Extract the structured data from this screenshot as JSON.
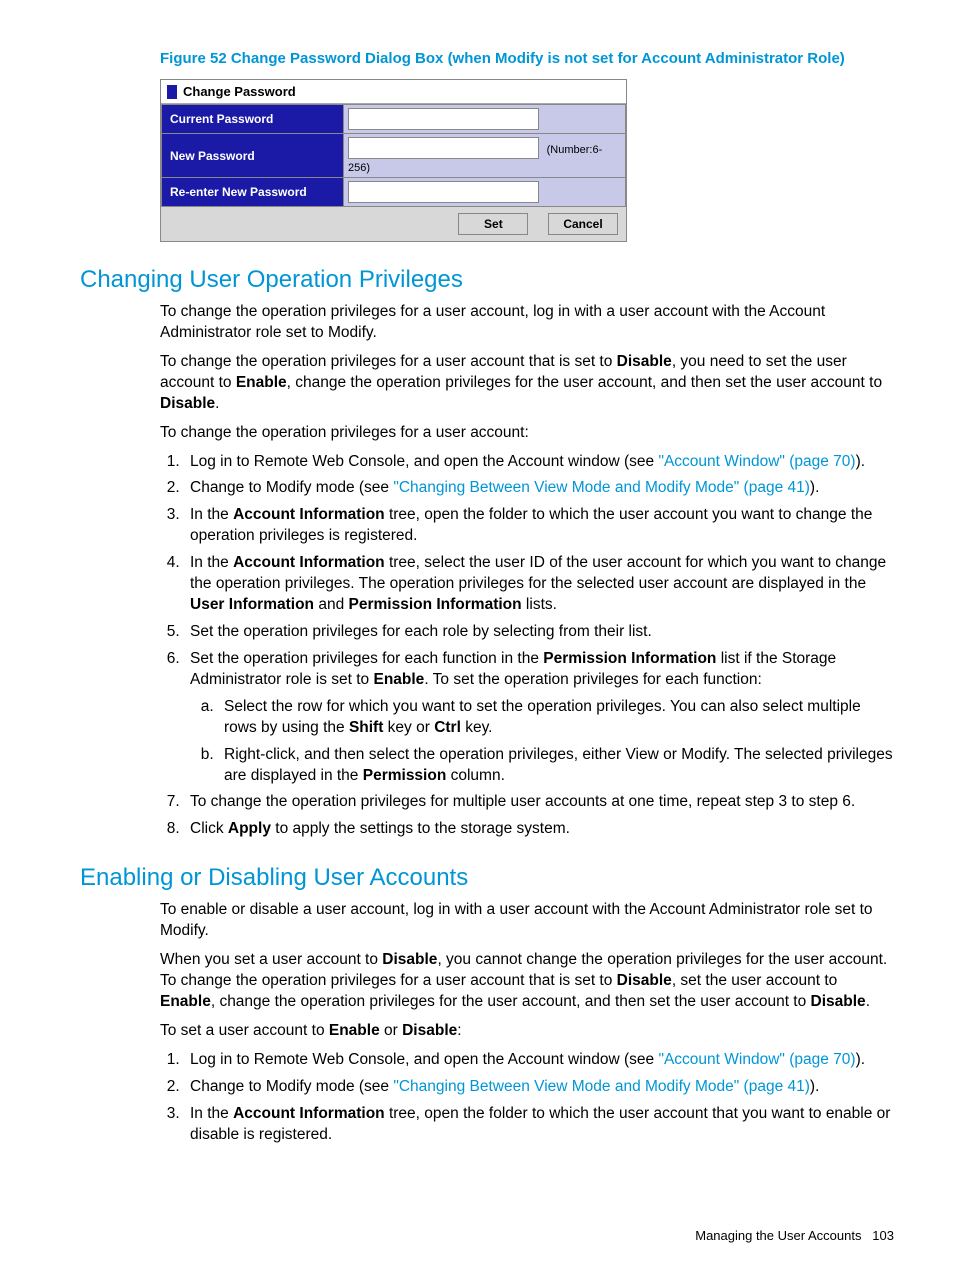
{
  "figure": {
    "caption": "Figure 52 Change Password Dialog Box (when Modify is not set for Account Administrator Role)",
    "dialog": {
      "title": "Change Password",
      "rows": {
        "current": "Current Password",
        "new": "New Password",
        "hint": "(Number:6-256)",
        "reenter": "Re-enter New Password"
      },
      "buttons": {
        "set": "Set",
        "cancel": "Cancel"
      }
    }
  },
  "section1": {
    "title": "Changing User Operation Privileges",
    "p1": "To change the operation privileges for a user account, log in with a user account with the Account Administrator role set to Modify.",
    "p2a": "To change the operation privileges for a user account that is set to ",
    "p2b": "Disable",
    "p2c": ", you need to set the user account to ",
    "p2d": "Enable",
    "p2e": ", change the operation privileges for the user account, and then set the user account to ",
    "p2f": "Disable",
    "p2g": ".",
    "p3": "To change the operation privileges for a user account:",
    "li1a": "Log in to Remote Web Console, and open the Account window (see ",
    "li1link": "\"Account Window\" (page 70)",
    "li1b": ").",
    "li2a": "Change to Modify mode (see ",
    "li2link": "\"Changing Between View Mode and Modify Mode\" (page 41)",
    "li2b": ").",
    "li3a": "In the ",
    "li3b": "Account Information",
    "li3c": " tree, open the folder to which the user account you want to change the operation privileges is registered.",
    "li4a": "In the ",
    "li4b": "Account Information",
    "li4c": " tree, select the user ID of the user account for which you want to change the operation privileges. The operation privileges for the selected user account are displayed in the ",
    "li4d": "User Information",
    "li4e": " and ",
    "li4f": "Permission Information",
    "li4g": " lists.",
    "li5": "Set the operation privileges for each role by selecting from their list.",
    "li6a": "Set the operation privileges for each function in the ",
    "li6b": "Permission Information",
    "li6c": " list if the Storage Administrator role is set to ",
    "li6d": "Enable",
    "li6e": ". To set the operation privileges for each function:",
    "li6sub_a1": "Select the row for which you want to set the operation privileges. You can also select multiple rows by using the ",
    "li6sub_a2": "Shift",
    "li6sub_a3": " key or ",
    "li6sub_a4": "Ctrl",
    "li6sub_a5": " key.",
    "li6sub_b1": "Right-click, and then select the operation privileges, either View or Modify. The selected privileges are displayed in the ",
    "li6sub_b2": "Permission",
    "li6sub_b3": " column.",
    "li7": "To change the operation privileges for multiple user accounts at one time, repeat step 3 to step 6.",
    "li8a": "Click ",
    "li8b": "Apply",
    "li8c": " to apply the settings to the storage system."
  },
  "section2": {
    "title": "Enabling or Disabling User Accounts",
    "p1": "To enable or disable a user account, log in with a user account with the Account Administrator role set to Modify.",
    "p2a": "When you set a user account to ",
    "p2b": "Disable",
    "p2c": ", you cannot change the operation privileges for the user account. To change the operation privileges for a user account that is set to ",
    "p2d": "Disable",
    "p2e": ", set the user account to ",
    "p2f": "Enable",
    "p2g": ", change the operation privileges for the user account, and then set the user account to ",
    "p2h": "Disable",
    "p2i": ".",
    "p3a": "To set a user account to ",
    "p3b": "Enable",
    "p3c": " or ",
    "p3d": "Disable",
    "p3e": ":",
    "li1a": "Log in to Remote Web Console, and open the Account window (see ",
    "li1link": "\"Account Window\" (page 70)",
    "li1b": ").",
    "li2a": "Change to Modify mode (see ",
    "li2link": "\"Changing Between View Mode and Modify Mode\" (page 41)",
    "li2b": ").",
    "li3a": "In the ",
    "li3b": "Account Information",
    "li3c": " tree, open the folder to which the user account that you want to enable or disable is registered."
  },
  "footer": {
    "text": "Managing the User Accounts",
    "page": "103"
  }
}
